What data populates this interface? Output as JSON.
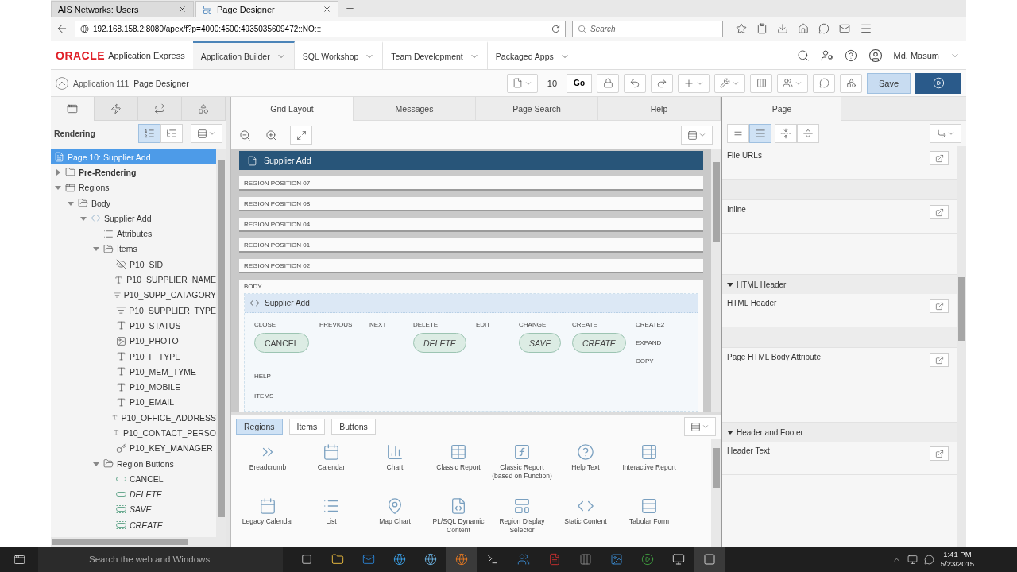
{
  "browser": {
    "tabs": [
      {
        "title": "AIS Networks: Users",
        "selected": false
      },
      {
        "title": "Page Designer",
        "selected": true
      }
    ],
    "url": "192.168.158.2:8080/apex/f?p=4000:4500:4935035609472::NO:::",
    "search_placeholder": "Search"
  },
  "apex_header": {
    "brand": "ORACLE",
    "product": "Application Express",
    "nav": [
      {
        "label": "Application Builder",
        "selected": true
      },
      {
        "label": "SQL Workshop",
        "selected": false
      },
      {
        "label": "Team Development",
        "selected": false
      },
      {
        "label": "Packaged Apps",
        "selected": false
      }
    ],
    "user": "Md. Masum"
  },
  "toolbar": {
    "breadcrumb": [
      "Application 111",
      "Page Designer"
    ],
    "page_number": "10",
    "go": "Go",
    "save": "Save"
  },
  "left_panel": {
    "tabs": [
      {
        "kind": "tree",
        "selected": true
      },
      {
        "kind": "bolt",
        "selected": false
      },
      {
        "kind": "process",
        "selected": false
      },
      {
        "kind": "shapes",
        "selected": false
      }
    ],
    "title": "Rendering",
    "views": [
      {
        "kind": "ordered",
        "selected": true
      },
      {
        "kind": "grouped",
        "selected": false
      }
    ],
    "tree": [
      {
        "label": "Page 10: Supplier Add",
        "kind": "page",
        "selected": true
      },
      {
        "label": "Pre-Rendering",
        "kind": "folder",
        "bold": true,
        "expanded": false,
        "selected": false
      },
      {
        "label": "Regions",
        "kind": "regions",
        "expanded": true,
        "selected": false,
        "children": [
          {
            "label": "Body",
            "kind": "folder_open",
            "expanded": true,
            "selected": false,
            "children": [
              {
                "label": "Supplier Add",
                "kind": "code",
                "expanded": true,
                "selected": false,
                "children": [
                  {
                    "label": "Attributes",
                    "kind": "list",
                    "selected": false
                  },
                  {
                    "label": "Items",
                    "kind": "folder_open",
                    "expanded": true,
                    "selected": false,
                    "children": [
                      {
                        "label": "P10_SID",
                        "kind": "hidden",
                        "selected": false
                      },
                      {
                        "label": "P10_SUPPLIER_NAME",
                        "kind": "text",
                        "selected": false
                      },
                      {
                        "label": "P10_SUPP_CATAGORY",
                        "kind": "select",
                        "selected": false
                      },
                      {
                        "label": "P10_SUPPLIER_TYPE",
                        "kind": "select",
                        "selected": false
                      },
                      {
                        "label": "P10_STATUS",
                        "kind": "text",
                        "selected": false
                      },
                      {
                        "label": "P10_PHOTO",
                        "kind": "file",
                        "selected": false
                      },
                      {
                        "label": "P10_F_TYPE",
                        "kind": "text",
                        "selected": false
                      },
                      {
                        "label": "P10_MEM_TYME",
                        "kind": "text",
                        "selected": false
                      },
                      {
                        "label": "P10_MOBILE",
                        "kind": "text",
                        "selected": false
                      },
                      {
                        "label": "P10_EMAIL",
                        "kind": "text",
                        "selected": false
                      },
                      {
                        "label": "P10_OFFICE_ADDRESS",
                        "kind": "text",
                        "selected": false
                      },
                      {
                        "label": "P10_CONTACT_PERSO",
                        "kind": "text",
                        "selected": false
                      },
                      {
                        "label": "P10_KEY_MANAGER",
                        "kind": "lov",
                        "selected": false
                      }
                    ]
                  },
                  {
                    "label": "Region Buttons",
                    "kind": "folder_open",
                    "expanded": true,
                    "selected": false,
                    "children": [
                      {
                        "label": "CANCEL",
                        "kind": "button",
                        "italic": false,
                        "selected": false
                      },
                      {
                        "label": "DELETE",
                        "kind": "button",
                        "italic": true,
                        "selected": false
                      },
                      {
                        "label": "SAVE",
                        "kind": "button_dashed",
                        "italic": true,
                        "selected": false
                      },
                      {
                        "label": "CREATE",
                        "kind": "button_dashed",
                        "italic": true,
                        "selected": false
                      }
                    ]
                  }
                ]
              }
            ]
          }
        ]
      }
    ]
  },
  "center": {
    "tabs": [
      {
        "label": "Grid Layout",
        "selected": true
      },
      {
        "label": "Messages",
        "selected": false
      },
      {
        "label": "Page Search",
        "selected": false
      },
      {
        "label": "Help",
        "selected": false
      }
    ],
    "page_title": "Supplier Add",
    "positions": [
      "REGION POSITION 07",
      "REGION POSITION 08",
      "REGION POSITION 04",
      "REGION POSITION 01",
      "REGION POSITION 02"
    ],
    "body_label": "BODY",
    "region_title": "Supplier Add",
    "button_positions": [
      {
        "label": "CLOSE",
        "button": {
          "label": "CANCEL",
          "italic": false
        }
      },
      {
        "label": "PREVIOUS"
      },
      {
        "label": "NEXT"
      },
      {
        "label": "DELETE",
        "button": {
          "label": "DELETE",
          "italic": true
        }
      },
      {
        "label": "EDIT"
      },
      {
        "label": "CHANGE",
        "button": {
          "label": "SAVE",
          "italic": true
        }
      },
      {
        "label": "CREATE",
        "button": {
          "label": "CREATE",
          "italic": true
        }
      },
      {
        "label": "CREATE2",
        "stacked": [
          "EXPAND",
          "COPY"
        ]
      }
    ],
    "lower_positions": [
      "HELP",
      "ITEMS"
    ]
  },
  "gallery": {
    "tabs": [
      {
        "label": "Regions",
        "selected": true
      },
      {
        "label": "Items",
        "selected": false
      },
      {
        "label": "Buttons",
        "selected": false
      }
    ],
    "items": [
      {
        "label": "Breadcrumb",
        "kind": "breadcrumb"
      },
      {
        "label": "Calendar",
        "kind": "calendar"
      },
      {
        "label": "Chart",
        "kind": "chart"
      },
      {
        "label": "Classic Report",
        "kind": "table"
      },
      {
        "label": "Classic Report (based on Function)",
        "kind": "function"
      },
      {
        "label": "Help Text",
        "kind": "help"
      },
      {
        "label": "Interactive Report",
        "kind": "interactive"
      },
      {
        "label": "Legacy Calendar",
        "kind": "calendar"
      },
      {
        "label": "List",
        "kind": "list"
      },
      {
        "label": "Map Chart",
        "kind": "map"
      },
      {
        "label": "PL/SQL Dynamic Content",
        "kind": "plsql"
      },
      {
        "label": "Region Display Selector",
        "kind": "selector"
      },
      {
        "label": "Static Content",
        "kind": "code"
      },
      {
        "label": "Tabular Form",
        "kind": "form"
      }
    ]
  },
  "right_panel": {
    "tab": "Page",
    "views": [
      {
        "kind": "compact",
        "selected": false
      },
      {
        "kind": "full",
        "selected": true
      }
    ],
    "properties": [
      {
        "kind": "field",
        "label": "File URLs"
      },
      {
        "kind": "band"
      },
      {
        "kind": "field",
        "label": "Inline"
      },
      {
        "kind": "blank"
      },
      {
        "kind": "group",
        "label": "HTML Header"
      },
      {
        "kind": "field",
        "label": "HTML Header"
      },
      {
        "kind": "band"
      },
      {
        "kind": "field",
        "label": "Page HTML Body Attribute"
      },
      {
        "kind": "group",
        "label": "Header and Footer"
      },
      {
        "kind": "field",
        "label": "Header Text"
      }
    ]
  },
  "taskbar": {
    "search_placeholder": "Search the web and Windows",
    "time": "1:41 PM",
    "date": "5/23/2015"
  }
}
